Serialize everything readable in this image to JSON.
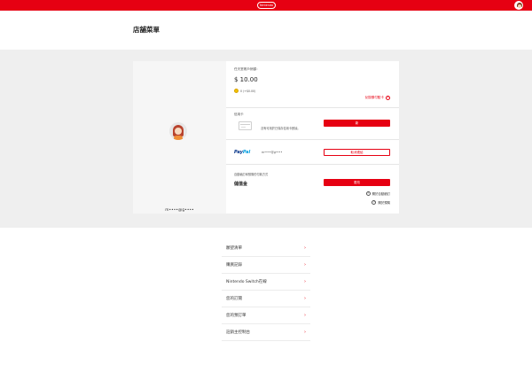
{
  "header": {
    "logo_text": "Nintendo",
    "page_title": "店舖菜單"
  },
  "user": {
    "name": "m••••@g••••"
  },
  "funds": {
    "label": "任天堂帳戶餘額：",
    "value": "$ 10.00",
    "points": "0 (+$0.00)",
    "redeem_label": "兌換預付點卡"
  },
  "credit_card": {
    "label": "信用卡",
    "empty_text": "沒有可用於已保存信用卡數據。",
    "add_button": "新"
  },
  "paypal": {
    "logo_pay": "Pay",
    "logo_pal": "Pal",
    "account": "m••••@g••••",
    "unlink_button": "取消連結"
  },
  "auto_renew": {
    "label": "自動續訂和預購的付款方式",
    "method": "儲值金",
    "change_button": "更改",
    "help_link_1": "關於自動續訂",
    "help_link_2": "關於預購"
  },
  "menu": {
    "items": [
      {
        "label": "願望清單"
      },
      {
        "label": "購買記錄"
      },
      {
        "label": "Nintendo Switch在線"
      },
      {
        "label": "您的訂閱"
      },
      {
        "label": "您的預訂單"
      },
      {
        "label": "註銷主控制台"
      }
    ],
    "chevron": "›"
  },
  "colors": {
    "accent": "#e60012",
    "paypal_dark": "#003087",
    "paypal_light": "#009cde"
  },
  "icons": {
    "help": "question-circle-icon",
    "menu_arrow": "chevron-right-icon"
  }
}
